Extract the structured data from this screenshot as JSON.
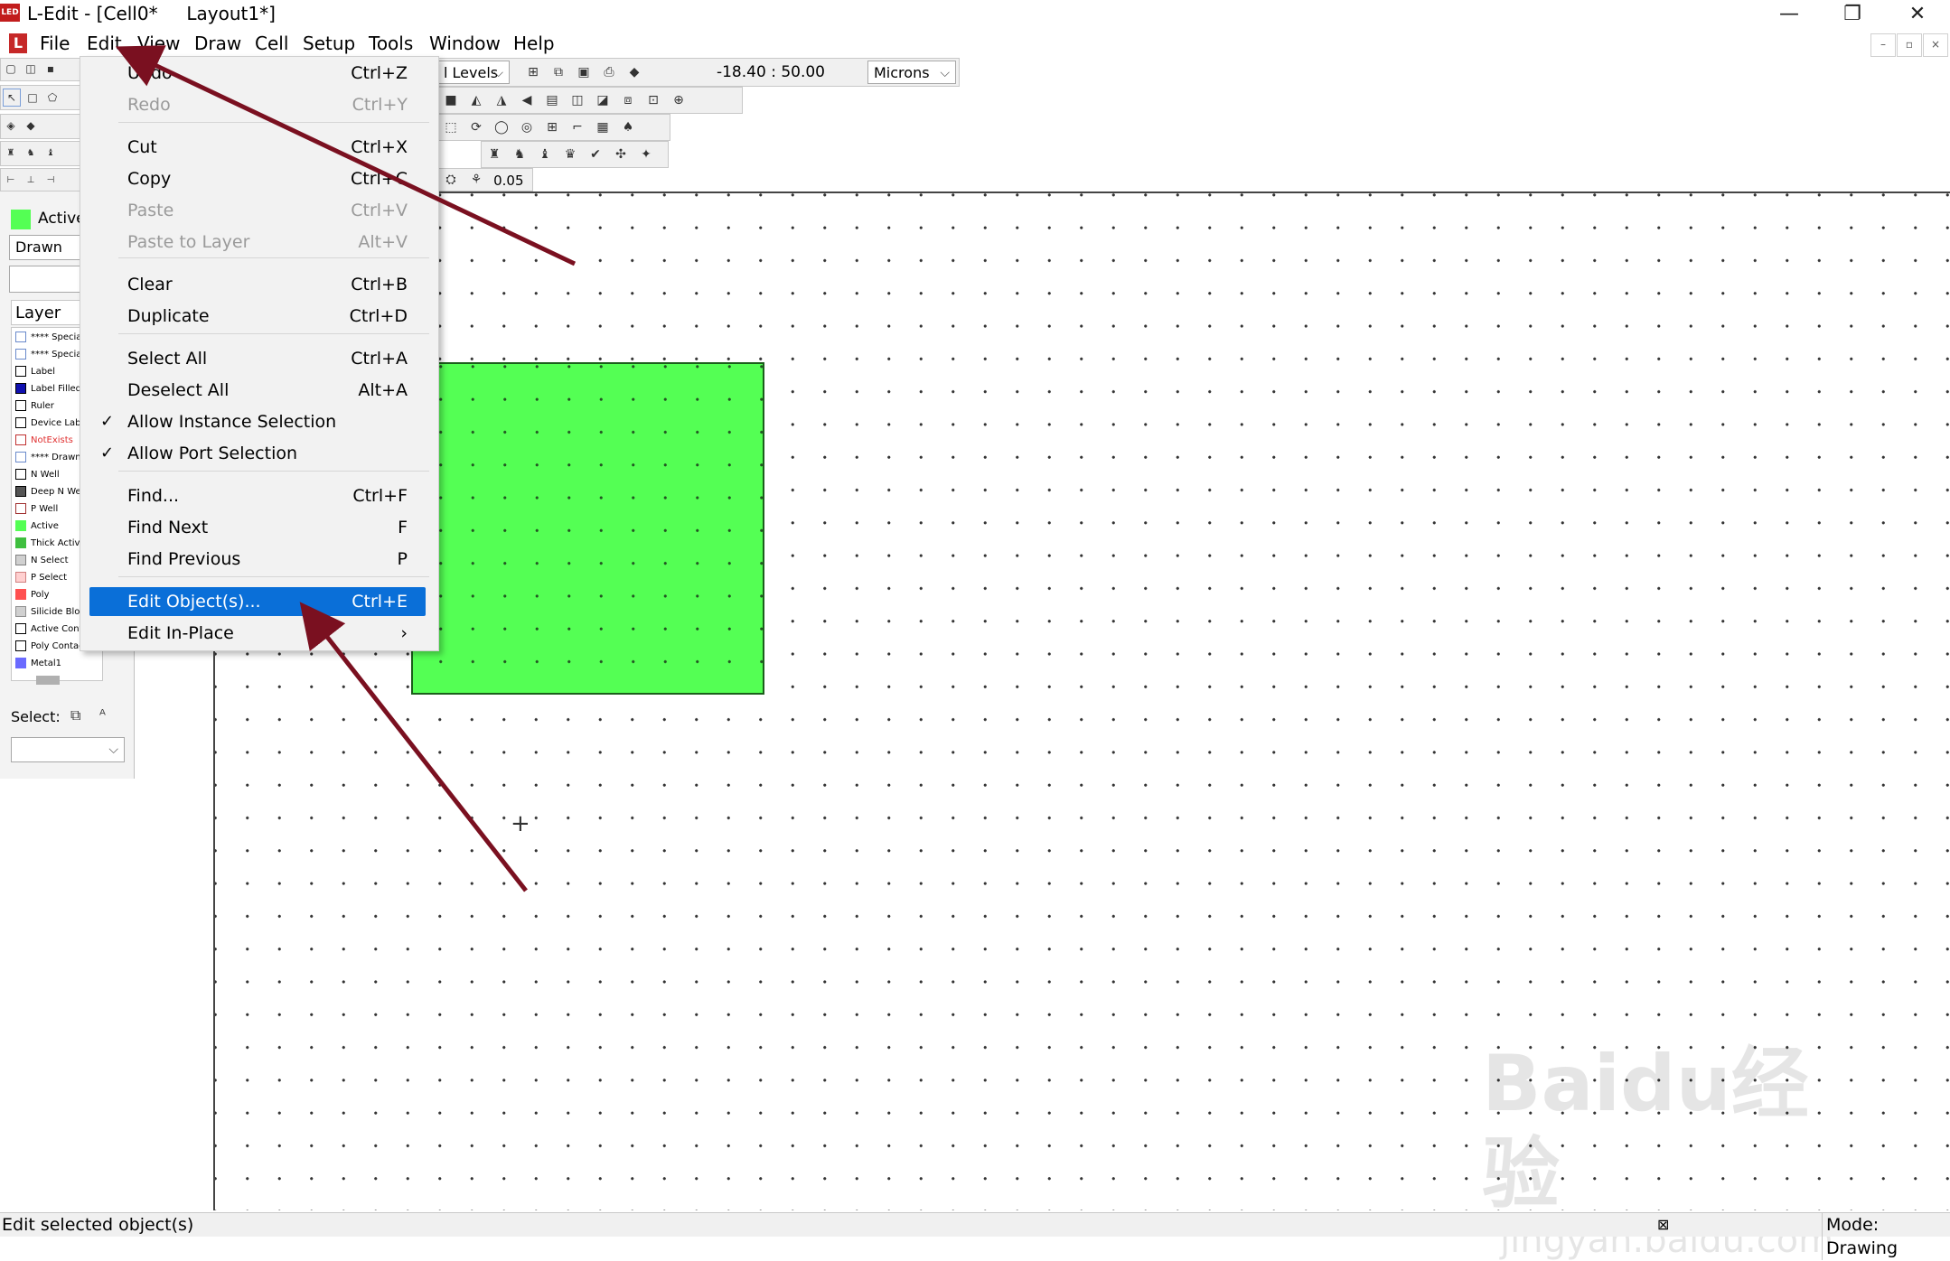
{
  "window": {
    "app_icon_text": "LED",
    "title": "L-Edit - [Cell0*     Layout1*]",
    "minimize": "—",
    "restore": "❐",
    "close": "✕"
  },
  "menubar": {
    "items": [
      "File",
      "Edit",
      "View",
      "Draw",
      "Cell",
      "Setup",
      "Tools",
      "Window",
      "Help"
    ],
    "app_icon_text": "L",
    "mdi_minimize": "–",
    "mdi_restore": "▫",
    "mdi_close": "×"
  },
  "toolbar": {
    "levels_combo": "l Levels",
    "coordinates": "-18.40 : 50.00",
    "units_combo": "Microns",
    "grid_value": "0.05"
  },
  "left_panel": {
    "active_layer_label": "Active",
    "drawn_combo": "Drawn",
    "layer_header": "Layer",
    "layers": [
      {
        "name": "**** Special",
        "color": "#ffffff",
        "border": "#6a8acb",
        "text_color": "#000000"
      },
      {
        "name": "**** Special",
        "color": "#ffffff",
        "border": "#6a8acb",
        "text_color": "#000000"
      },
      {
        "name": "Label",
        "color": "#ffffff",
        "border": "#000000",
        "text_color": "#000000"
      },
      {
        "name": "Label Filled",
        "color": "#1010b0",
        "border": "#000000",
        "text_color": "#000000"
      },
      {
        "name": "Ruler",
        "color": "#ffffff",
        "border": "#000000",
        "text_color": "#000000"
      },
      {
        "name": "Device Label",
        "color": "#ffffff",
        "border": "#000000",
        "text_color": "#000000"
      },
      {
        "name": "NotExists",
        "color": "#ffffff",
        "border": "#c03030",
        "text_color": "#e03030"
      },
      {
        "name": "**** Drawn",
        "color": "#ffffff",
        "border": "#6a8acb",
        "text_color": "#000000"
      },
      {
        "name": "N Well",
        "color": "#ffffff",
        "border": "#000000",
        "text_color": "#000000"
      },
      {
        "name": "Deep N Well",
        "color": "#555555",
        "border": "#000000",
        "text_color": "#000000"
      },
      {
        "name": "P Well",
        "color": "#ffffff",
        "border": "#a03030",
        "text_color": "#000000"
      },
      {
        "name": "Active",
        "color": "#54ff54",
        "border": "#54ff54",
        "text_color": "#000000"
      },
      {
        "name": "Thick Active",
        "color": "#3fbf3f",
        "border": "#3fbf3f",
        "text_color": "#000000"
      },
      {
        "name": "N Select",
        "color": "#d0d0d0",
        "border": "#808080",
        "text_color": "#000000"
      },
      {
        "name": "P Select",
        "color": "#ffd0d0",
        "border": "#d08080",
        "text_color": "#000000"
      },
      {
        "name": "Poly",
        "color": "#ff5050",
        "border": "#ff5050",
        "text_color": "#000000"
      },
      {
        "name": "Silicide Block",
        "color": "#d0d0d0",
        "border": "#909090",
        "text_color": "#000000"
      },
      {
        "name": "Active Contact",
        "color": "#ffffff",
        "border": "#000000",
        "text_color": "#000000"
      },
      {
        "name": "Poly Contact",
        "color": "#ffffff",
        "border": "#000000",
        "text_color": "#000000"
      },
      {
        "name": "Metal1",
        "color": "#6a6aff",
        "border": "#6a6aff",
        "text_color": "#000000"
      }
    ],
    "select_label": "Select:"
  },
  "edit_menu": {
    "items": [
      {
        "label": "Undo",
        "shortcut": "Ctrl+Z",
        "disabled": false,
        "checked": false
      },
      {
        "label": "Redo",
        "shortcut": "Ctrl+Y",
        "disabled": true,
        "checked": false
      },
      {
        "label": "Cut",
        "shortcut": "Ctrl+X",
        "disabled": false,
        "checked": false
      },
      {
        "label": "Copy",
        "shortcut": "Ctrl+C",
        "disabled": false,
        "checked": false
      },
      {
        "label": "Paste",
        "shortcut": "Ctrl+V",
        "disabled": true,
        "checked": false
      },
      {
        "label": "Paste to Layer",
        "shortcut": "Alt+V",
        "disabled": true,
        "checked": false
      },
      {
        "label": "Clear",
        "shortcut": "Ctrl+B",
        "disabled": false,
        "checked": false
      },
      {
        "label": "Duplicate",
        "shortcut": "Ctrl+D",
        "disabled": false,
        "checked": false
      },
      {
        "label": "Select All",
        "shortcut": "Ctrl+A",
        "disabled": false,
        "checked": false
      },
      {
        "label": "Deselect All",
        "shortcut": "Alt+A",
        "disabled": false,
        "checked": false
      },
      {
        "label": "Allow Instance Selection",
        "shortcut": "",
        "disabled": false,
        "checked": true
      },
      {
        "label": "Allow Port Selection",
        "shortcut": "",
        "disabled": false,
        "checked": true
      },
      {
        "label": "Find...",
        "shortcut": "Ctrl+F",
        "disabled": false,
        "checked": false
      },
      {
        "label": "Find Next",
        "shortcut": "F",
        "disabled": false,
        "checked": false
      },
      {
        "label": "Find Previous",
        "shortcut": "P",
        "disabled": false,
        "checked": false
      },
      {
        "label": "Edit Object(s)...",
        "shortcut": "Ctrl+E",
        "disabled": false,
        "checked": false,
        "highlighted": true
      },
      {
        "label": "Edit In-Place",
        "shortcut": "›",
        "disabled": false,
        "checked": false
      }
    ],
    "check_mark": "✓"
  },
  "statusbar": {
    "message": "Edit selected object(s)",
    "mode": "Mode: Drawing"
  },
  "watermark": {
    "line1": "Baidu经验",
    "line2": "jingyan.baidu.com"
  },
  "colors": {
    "highlight": "#0a6fd8",
    "annotation_arrow": "#7a1020",
    "active_fill": "#54ff54"
  }
}
